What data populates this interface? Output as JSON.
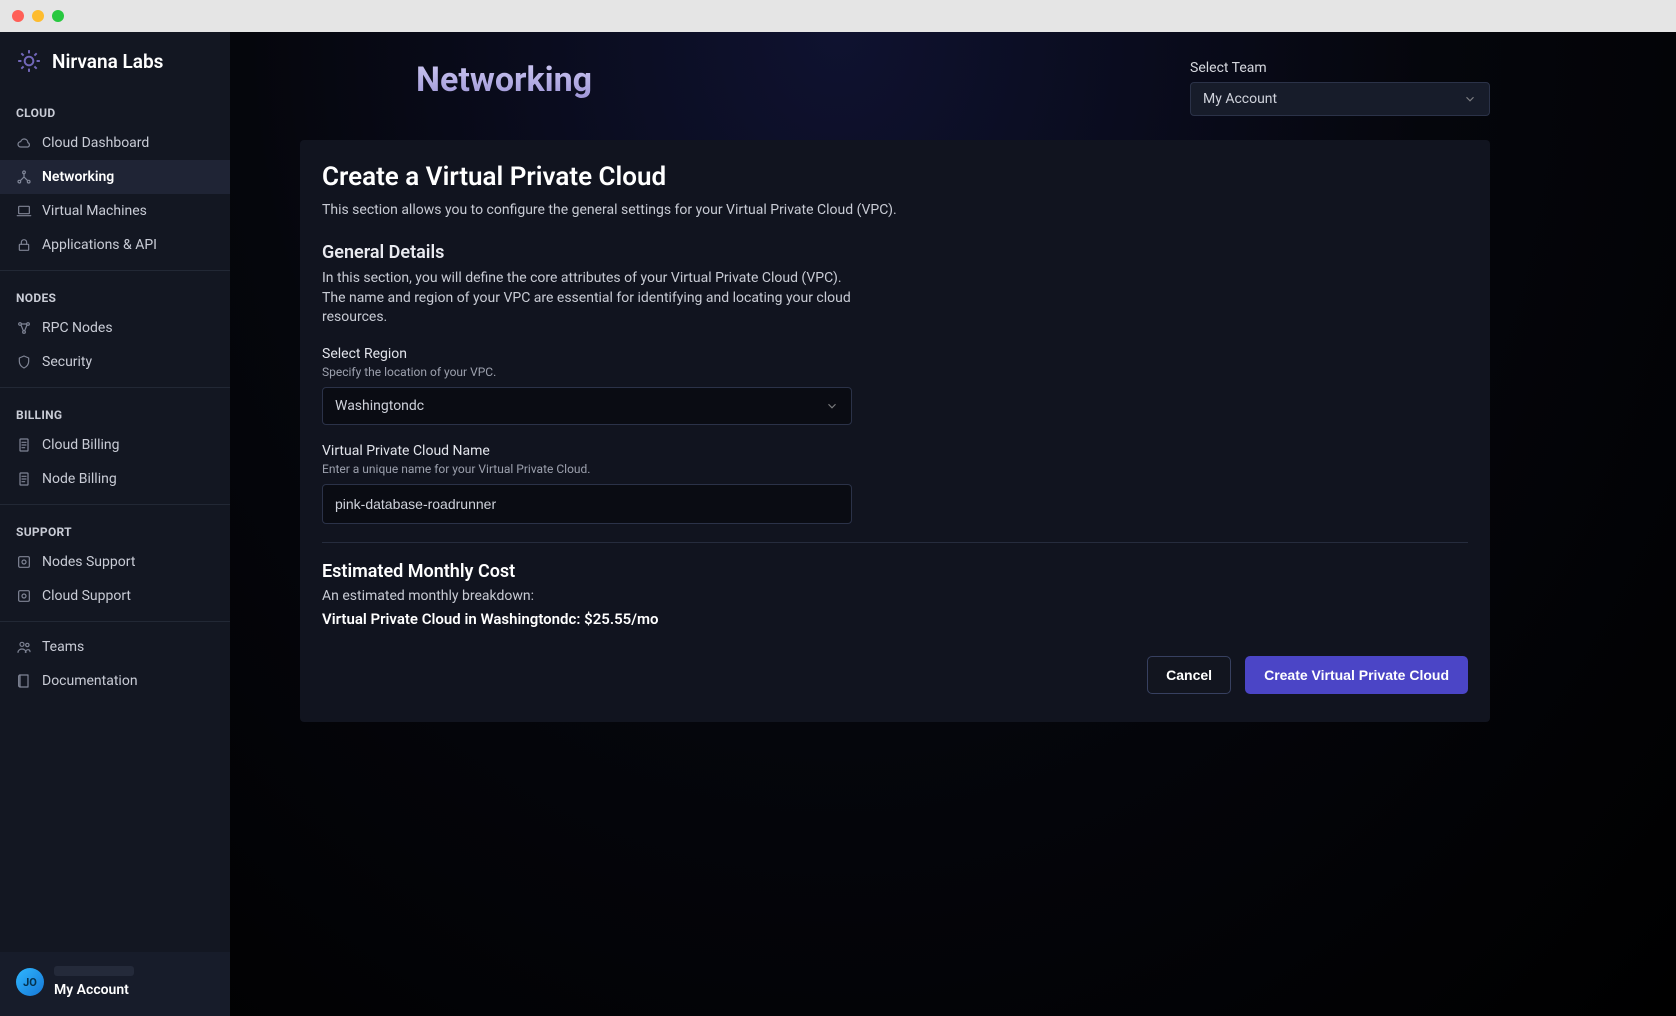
{
  "brand": {
    "name": "Nirvana Labs"
  },
  "sidebar": {
    "sections": [
      {
        "label": "CLOUD",
        "items": [
          {
            "label": "Cloud Dashboard",
            "icon": "cloud-icon",
            "active": false
          },
          {
            "label": "Networking",
            "icon": "network-icon",
            "active": true
          },
          {
            "label": "Virtual Machines",
            "icon": "laptop-icon",
            "active": false
          },
          {
            "label": "Applications & API",
            "icon": "lock-icon",
            "active": false
          }
        ]
      },
      {
        "label": "NODES",
        "items": [
          {
            "label": "RPC Nodes",
            "icon": "nodes-icon",
            "active": false
          },
          {
            "label": "Security",
            "icon": "shield-icon",
            "active": false
          }
        ]
      },
      {
        "label": "BILLING",
        "items": [
          {
            "label": "Cloud Billing",
            "icon": "receipt-icon",
            "active": false
          },
          {
            "label": "Node Billing",
            "icon": "receipt-icon",
            "active": false
          }
        ]
      },
      {
        "label": "SUPPORT",
        "items": [
          {
            "label": "Nodes Support",
            "icon": "support-icon",
            "active": false
          },
          {
            "label": "Cloud Support",
            "icon": "support-icon",
            "active": false
          }
        ]
      },
      {
        "label": "",
        "items": [
          {
            "label": "Teams",
            "icon": "people-icon",
            "active": false
          },
          {
            "label": "Documentation",
            "icon": "book-icon",
            "active": false
          }
        ]
      }
    ]
  },
  "account": {
    "initials": "JO",
    "name": "My Account"
  },
  "header": {
    "title": "Networking",
    "team_label": "Select Team",
    "team_selected": "My Account"
  },
  "panel": {
    "title": "Create a Virtual Private Cloud",
    "desc": "This section allows you to configure the general settings for your Virtual Private Cloud (VPC).",
    "general_heading": "General Details",
    "general_desc": "In this section, you will define the core attributes of your Virtual Private Cloud (VPC). The name and region of your VPC are essential for identifying and locating your cloud resources.",
    "region": {
      "label": "Select Region",
      "hint": "Specify the location of your VPC.",
      "value": "Washingtondc"
    },
    "name": {
      "label": "Virtual Private Cloud Name",
      "hint": "Enter a unique name for your Virtual Private Cloud.",
      "value": "pink-database-roadrunner"
    },
    "cost": {
      "heading": "Estimated Monthly Cost",
      "desc": "An estimated monthly breakdown:",
      "line_prefix": "Virtual Private Cloud in Washingtondc: ",
      "amount": "$25.55",
      "suffix": "/mo"
    },
    "buttons": {
      "cancel": "Cancel",
      "create": "Create Virtual Private Cloud"
    }
  }
}
